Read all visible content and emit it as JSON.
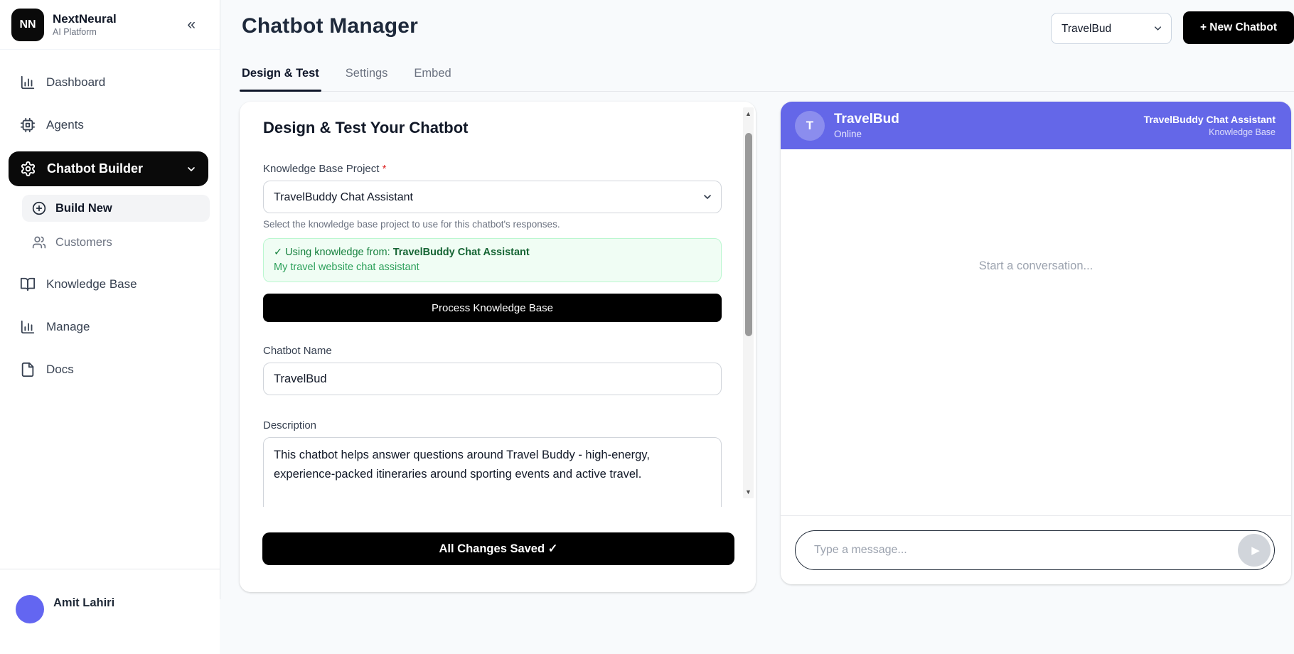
{
  "brand": {
    "logo_initials": "NN",
    "name": "NextNeural",
    "tagline": "AI Platform"
  },
  "icons": {
    "collapse": "«",
    "send": "▶",
    "scroll_up": "▲",
    "scroll_down": "▼"
  },
  "sidebar": {
    "items": [
      {
        "label": "Dashboard"
      },
      {
        "label": "Agents"
      },
      {
        "label": "Chatbot Builder"
      },
      {
        "label": "Build New"
      },
      {
        "label": "Customers"
      },
      {
        "label": "Knowledge Base"
      },
      {
        "label": "Manage"
      },
      {
        "label": "Docs"
      }
    ],
    "user": {
      "name": "Amit Lahiri"
    }
  },
  "header": {
    "title": "Chatbot Manager",
    "chatbot_select_value": "TravelBud",
    "new_chatbot_label": "+ New Chatbot"
  },
  "tabs": [
    {
      "label": "Design & Test"
    },
    {
      "label": "Settings"
    },
    {
      "label": "Embed"
    }
  ],
  "builder_panel": {
    "heading": "Design & Test Your Chatbot",
    "kb_label": "Knowledge Base Project",
    "required_mark": "*",
    "kb_select_value": "TravelBuddy Chat Assistant",
    "kb_help": "Select the knowledge base project to use for this chatbot's responses.",
    "kb_status_prefix": "✓ Using knowledge from: ",
    "kb_status_name": "TravelBuddy Chat Assistant",
    "kb_status_desc": "My travel website chat assistant",
    "process_button": "Process Knowledge Base",
    "name_label": "Chatbot Name",
    "name_value": "TravelBud",
    "description_label": "Description",
    "description_value": "This chatbot helps answer questions around Travel Buddy - high-energy, experience-packed itineraries around sporting events and active travel.",
    "save_button": "All Changes Saved ✓"
  },
  "chat_preview": {
    "avatar_initial": "T",
    "title": "TravelBud",
    "status": "Online",
    "kb_name": "TravelBuddy Chat Assistant",
    "kb_caption": "Knowledge Base",
    "empty_state": "Start a conversation...",
    "input_placeholder": "Type a message..."
  },
  "colors": {
    "accent_purple": "#6467e8",
    "sidebar_active": "#0a0a0a",
    "success_bg": "#f0fdf4",
    "success_border": "#bbf7d0",
    "success_text": "#15803d",
    "button_black": "#000000",
    "page_bg": "#f8fafc"
  }
}
